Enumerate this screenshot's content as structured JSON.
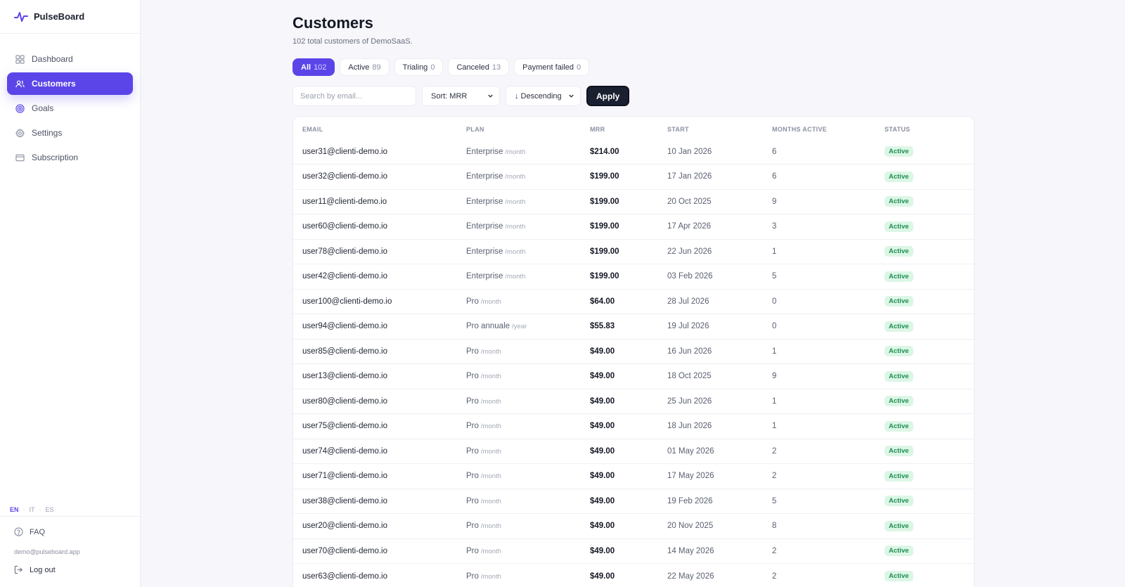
{
  "app": {
    "name": "PulseBoard",
    "accent": "#5b45e8"
  },
  "sidebar": {
    "items": [
      {
        "label": "Dashboard",
        "icon": "dashboard-icon",
        "active": false
      },
      {
        "label": "Customers",
        "icon": "users-icon",
        "active": true
      },
      {
        "label": "Goals",
        "icon": "target-icon",
        "active": false
      },
      {
        "label": "Settings",
        "icon": "gear-icon",
        "active": false
      },
      {
        "label": "Subscription",
        "icon": "credit-card-icon",
        "active": false
      }
    ],
    "languages": [
      "EN",
      "IT",
      "ES"
    ],
    "active_language": "EN",
    "faq_label": "FAQ",
    "user_email": "demo@pulseboard.app",
    "logout_label": "Log out"
  },
  "page": {
    "title": "Customers",
    "subtitle": "102 total customers of DemoSaaS."
  },
  "filters": [
    {
      "label": "All",
      "count": "102",
      "active": true
    },
    {
      "label": "Active",
      "count": "89",
      "active": false
    },
    {
      "label": "Trialing",
      "count": "0",
      "active": false
    },
    {
      "label": "Canceled",
      "count": "13",
      "active": false
    },
    {
      "label": "Payment failed",
      "count": "0",
      "active": false
    }
  ],
  "controls": {
    "search_placeholder": "Search by email...",
    "search_value": "",
    "sort_label": "Sort: MRR",
    "order_label": "↓ Descending",
    "apply_label": "Apply"
  },
  "table": {
    "headers": [
      "EMAIL",
      "PLAN",
      "MRR",
      "START",
      "MONTHS ACTIVE",
      "STATUS"
    ],
    "rows": [
      {
        "email": "user31@clienti-demo.io",
        "plan": "Enterprise",
        "period": "/month",
        "mrr": "$214.00",
        "start": "10 Jan 2026",
        "months": "6",
        "status": "Active"
      },
      {
        "email": "user32@clienti-demo.io",
        "plan": "Enterprise",
        "period": "/month",
        "mrr": "$199.00",
        "start": "17 Jan 2026",
        "months": "6",
        "status": "Active"
      },
      {
        "email": "user11@clienti-demo.io",
        "plan": "Enterprise",
        "period": "/month",
        "mrr": "$199.00",
        "start": "20 Oct 2025",
        "months": "9",
        "status": "Active"
      },
      {
        "email": "user60@clienti-demo.io",
        "plan": "Enterprise",
        "period": "/month",
        "mrr": "$199.00",
        "start": "17 Apr 2026",
        "months": "3",
        "status": "Active"
      },
      {
        "email": "user78@clienti-demo.io",
        "plan": "Enterprise",
        "period": "/month",
        "mrr": "$199.00",
        "start": "22 Jun 2026",
        "months": "1",
        "status": "Active"
      },
      {
        "email": "user42@clienti-demo.io",
        "plan": "Enterprise",
        "period": "/month",
        "mrr": "$199.00",
        "start": "03 Feb 2026",
        "months": "5",
        "status": "Active"
      },
      {
        "email": "user100@clienti-demo.io",
        "plan": "Pro",
        "period": "/month",
        "mrr": "$64.00",
        "start": "28 Jul 2026",
        "months": "0",
        "status": "Active"
      },
      {
        "email": "user94@clienti-demo.io",
        "plan": "Pro annuale",
        "period": "/year",
        "mrr": "$55.83",
        "start": "19 Jul 2026",
        "months": "0",
        "status": "Active"
      },
      {
        "email": "user85@clienti-demo.io",
        "plan": "Pro",
        "period": "/month",
        "mrr": "$49.00",
        "start": "16 Jun 2026",
        "months": "1",
        "status": "Active"
      },
      {
        "email": "user13@clienti-demo.io",
        "plan": "Pro",
        "period": "/month",
        "mrr": "$49.00",
        "start": "18 Oct 2025",
        "months": "9",
        "status": "Active"
      },
      {
        "email": "user80@clienti-demo.io",
        "plan": "Pro",
        "period": "/month",
        "mrr": "$49.00",
        "start": "25 Jun 2026",
        "months": "1",
        "status": "Active"
      },
      {
        "email": "user75@clienti-demo.io",
        "plan": "Pro",
        "period": "/month",
        "mrr": "$49.00",
        "start": "18 Jun 2026",
        "months": "1",
        "status": "Active"
      },
      {
        "email": "user74@clienti-demo.io",
        "plan": "Pro",
        "period": "/month",
        "mrr": "$49.00",
        "start": "01 May 2026",
        "months": "2",
        "status": "Active"
      },
      {
        "email": "user71@clienti-demo.io",
        "plan": "Pro",
        "period": "/month",
        "mrr": "$49.00",
        "start": "17 May 2026",
        "months": "2",
        "status": "Active"
      },
      {
        "email": "user38@clienti-demo.io",
        "plan": "Pro",
        "period": "/month",
        "mrr": "$49.00",
        "start": "19 Feb 2026",
        "months": "5",
        "status": "Active"
      },
      {
        "email": "user20@clienti-demo.io",
        "plan": "Pro",
        "period": "/month",
        "mrr": "$49.00",
        "start": "20 Nov 2025",
        "months": "8",
        "status": "Active"
      },
      {
        "email": "user70@clienti-demo.io",
        "plan": "Pro",
        "period": "/month",
        "mrr": "$49.00",
        "start": "14 May 2026",
        "months": "2",
        "status": "Active"
      },
      {
        "email": "user63@clienti-demo.io",
        "plan": "Pro",
        "period": "/month",
        "mrr": "$49.00",
        "start": "22 May 2026",
        "months": "2",
        "status": "Active"
      }
    ]
  }
}
